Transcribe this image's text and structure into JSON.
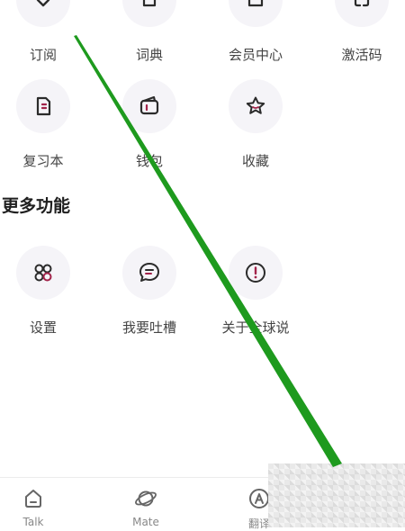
{
  "colors": {
    "accent": "#a2234a",
    "icon_stroke": "#2b2b2b",
    "swipe_line": "#1e9a1e"
  },
  "grid_top": [
    {
      "label": "订阅",
      "icon": "subscribe-icon"
    },
    {
      "label": "词典",
      "icon": "dictionary-icon"
    },
    {
      "label": "会员中心",
      "icon": "member-center-icon"
    },
    {
      "label": "激活码",
      "icon": "activation-code-icon"
    }
  ],
  "grid_mid": [
    {
      "label": "复习本",
      "icon": "review-notebook-icon"
    },
    {
      "label": "钱包",
      "icon": "wallet-icon"
    },
    {
      "label": "收藏",
      "icon": "star-icon"
    }
  ],
  "more_section": {
    "title": "更多功能",
    "items": [
      {
        "label": "设置",
        "icon": "settings-grid-icon"
      },
      {
        "label": "我要吐槽",
        "icon": "feedback-chat-icon"
      },
      {
        "label": "关于全球说",
        "icon": "info-exclamation-icon"
      }
    ]
  },
  "bottom_nav": [
    {
      "label": "Talk",
      "icon": "home-icon"
    },
    {
      "label": "Mate",
      "icon": "planet-icon"
    },
    {
      "label": "翻译",
      "icon": "translate-icon"
    }
  ]
}
